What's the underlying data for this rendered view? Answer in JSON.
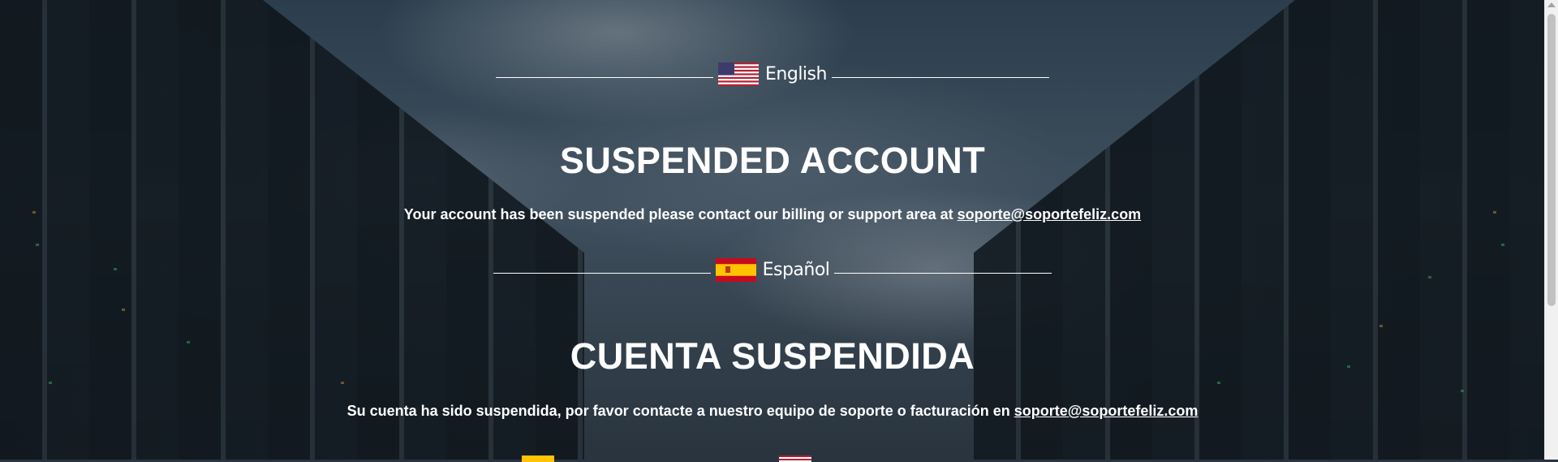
{
  "sections": [
    {
      "language_label": "English",
      "flag_icon": "us-flag-icon",
      "title": "SUSPENDED ACCOUNT",
      "message": "Your account has been suspended please contact our billing or support area at",
      "email": "soporte@soportefeliz.com"
    },
    {
      "language_label": "Español",
      "flag_icon": "spain-flag-icon",
      "title": "CUENTA SUSPENDIDA",
      "message": "Su cuenta ha sido suspendida, por favor contacte a nuestro equipo de soporte o facturación en",
      "email": "soporte@soportefeliz.com"
    }
  ],
  "colors": {
    "text": "#ffffff",
    "scrollbar_track": "#f1f1f1",
    "scrollbar_thumb": "#c1c1c1"
  }
}
